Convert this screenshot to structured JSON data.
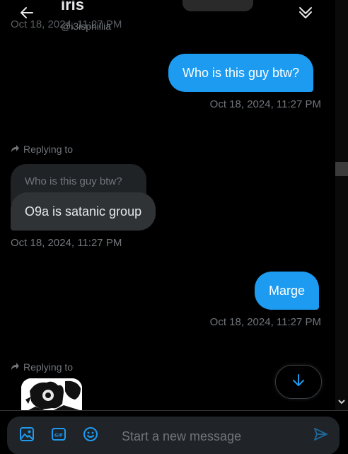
{
  "colors": {
    "accent": "#1d9bf0",
    "background": "#000000",
    "incoming_bubble": "#2f3336",
    "muted_text": "#71767b"
  },
  "header": {
    "name": "iris",
    "handle": "@i3isphillia",
    "ghost_time": "Oct 18, 2024, 11:27 PM",
    "back_icon": "arrow-left-icon",
    "collapse_icon": "double-chevron-down-icon"
  },
  "messages": [
    {
      "direction": "out",
      "text": "Who is this guy btw?",
      "time": "Oct 18, 2024, 11:27 PM"
    },
    {
      "direction": "in",
      "replying_label": "Replying to",
      "quoted_text": "Who is this guy btw?",
      "text": "O9a is satanic group",
      "time": "Oct 18, 2024, 11:27 PM"
    },
    {
      "direction": "out",
      "text": "Marge",
      "time": "Oct 18, 2024, 11:27 PM"
    },
    {
      "direction": "in",
      "replying_label": "Replying to",
      "media": "image"
    }
  ],
  "scroll_button": {
    "icon": "arrow-down-icon"
  },
  "composer": {
    "placeholder": "Start a new message",
    "icons": [
      "image-icon",
      "gif-icon",
      "emoji-icon",
      "send-icon"
    ]
  }
}
